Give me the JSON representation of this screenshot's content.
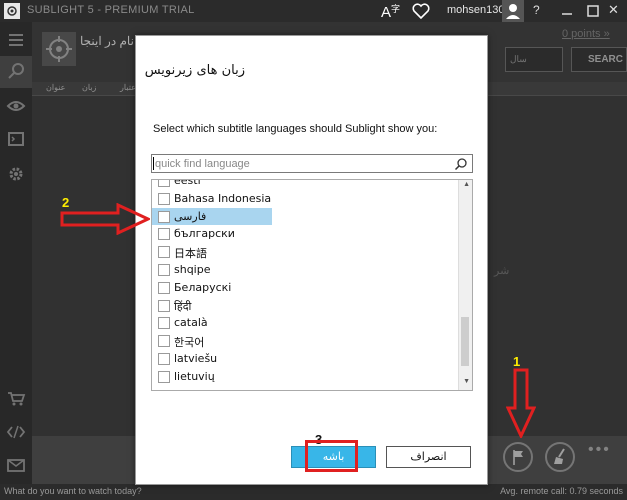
{
  "window": {
    "title": "SUBLIGHT 5 - PREMIUM TRIAL",
    "username": "mohsen130",
    "help": "?",
    "close": "✕"
  },
  "background": {
    "title_text": "نام در اینجا",
    "points_link": "0 points »",
    "year_placeholder": "سال",
    "search_button": "SEARC",
    "columns": [
      "اعتبار",
      "زبان",
      "عنوان"
    ],
    "watermark_text": "شر"
  },
  "status": {
    "prompt": "What do you want to watch today?",
    "remote": "Avg. remote call: 0.79 seconds"
  },
  "dialog": {
    "title": "زبان های زیرنویس",
    "instruction": "Select which subtitle languages should Sublight show you:",
    "quick_find_placeholder": "quick find language",
    "languages": [
      {
        "label": "eesti",
        "checked": false,
        "selected": false
      },
      {
        "label": "Bahasa Indonesia",
        "checked": false,
        "selected": false
      },
      {
        "label": "فارسی",
        "checked": false,
        "selected": true
      },
      {
        "label": "български",
        "checked": false,
        "selected": false
      },
      {
        "label": "日本語",
        "checked": false,
        "selected": false
      },
      {
        "label": "shqipe",
        "checked": false,
        "selected": false
      },
      {
        "label": "Беларускі",
        "checked": false,
        "selected": false
      },
      {
        "label": "हिंदी",
        "checked": false,
        "selected": false
      },
      {
        "label": "català",
        "checked": false,
        "selected": false
      },
      {
        "label": "한국어",
        "checked": false,
        "selected": false
      },
      {
        "label": "latviešu",
        "checked": false,
        "selected": false
      },
      {
        "label": "lietuvių",
        "checked": false,
        "selected": false
      }
    ],
    "ok_button": "باشه",
    "cancel_button": "انصراف"
  },
  "annotations": {
    "step1": "1",
    "step2": "2",
    "step3": "3",
    "color": "#e02020"
  },
  "colors": {
    "accent": "#38b6e8",
    "selection": "#a9d5ef",
    "annotation_red": "#e02020",
    "annotation_yellow": "#ffee00"
  }
}
